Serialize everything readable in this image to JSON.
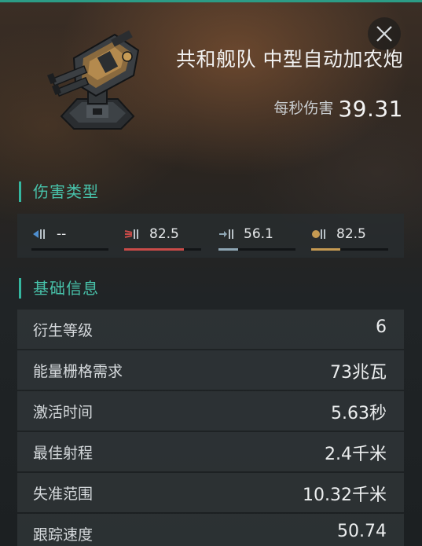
{
  "header": {
    "item_name": "共和舰队 中型自动加农炮",
    "dps_label": "每秒伤害",
    "dps_value": "39.31"
  },
  "icons": {
    "close": "close-icon",
    "item": "autocannon-turret-icon"
  },
  "damage_section": {
    "title": "伤害类型",
    "types": [
      {
        "icon": "em-damage-icon",
        "value": "--",
        "fill": 0.0,
        "color": "#4f8fd0"
      },
      {
        "icon": "thermal-damage-icon",
        "value": "82.5",
        "fill": 0.78,
        "color": "#c94b48"
      },
      {
        "icon": "kinetic-damage-icon",
        "value": "56.1",
        "fill": 0.26,
        "color": "#8ea6b4"
      },
      {
        "icon": "explosive-damage-icon",
        "value": "82.5",
        "fill": 0.38,
        "color": "#c59a52"
      }
    ]
  },
  "basic_section": {
    "title": "基础信息",
    "rows": [
      {
        "label": "衍生等级",
        "value": "6"
      },
      {
        "label": "能量栅格需求",
        "value": "73兆瓦"
      },
      {
        "label": "激活时间",
        "value": "5.63秒"
      },
      {
        "label": "最佳射程",
        "value": "2.4千米"
      },
      {
        "label": "失准范围",
        "value": "10.32千米"
      },
      {
        "label": "跟踪速度",
        "value": "50.74"
      }
    ]
  },
  "colors": {
    "accent": "#35b7a0",
    "section_title": "#48c2aa"
  }
}
